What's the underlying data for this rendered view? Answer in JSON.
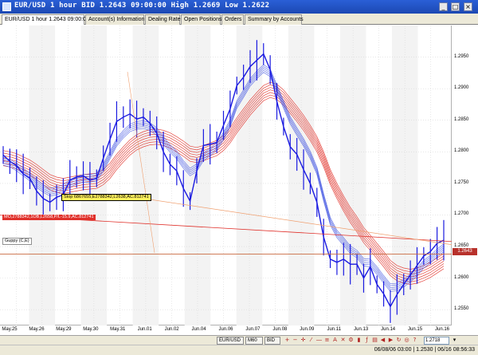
{
  "window": {
    "title": "EUR/USD 1 hour BID 1.2643 09:00:00 High 1.2669 Low 1.2622",
    "minimize": "_",
    "maximize": "□",
    "close": "×"
  },
  "tabs": [
    {
      "label": "EUR/USD 1 hour 1.2643 09:00:00"
    },
    {
      "label": "Account(s) Information"
    },
    {
      "label": "Dealing Rates"
    },
    {
      "label": "Open Positions"
    },
    {
      "label": "Orders"
    },
    {
      "label": "Summary by Accounts"
    }
  ],
  "chart": {
    "annotations": {
      "stop": "Stop 6867655,E2788342,L2638,AC.812741",
      "mo": "MO,2788342,1OB,L2658,P/L-15.9,AC.812741",
      "guppy": "Guppy (C,E)"
    },
    "current_price": "1.2643"
  },
  "chart_data": {
    "type": "line",
    "title": "EUR/USD 1 hour BID",
    "ylim": [
      1.2525,
      1.3
    ],
    "yticks": [
      "1.2950",
      "1.2900",
      "1.2850",
      "1.2800",
      "1.2750",
      "1.2700",
      "1.2650",
      "1.2600",
      "1.2550"
    ],
    "xticks": [
      "May.25",
      "May.26",
      "May.29",
      "May.30",
      "May.31",
      "Jun.01",
      "Jun.02",
      "Jun.04",
      "Jun.06",
      "Jun.07",
      "Jun.08",
      "Jun.09",
      "Jun.11",
      "Jun.13",
      "Jun.14",
      "Jun.15",
      "Jun.16"
    ],
    "price": [
      1.2795,
      1.2785,
      1.2778,
      1.2765,
      1.2758,
      1.2738,
      1.2726,
      1.272,
      1.2728,
      1.2732,
      1.2755,
      1.276,
      1.2762,
      1.2755,
      1.2758,
      1.279,
      1.282,
      1.2848,
      1.2855,
      1.286,
      1.2852,
      1.2855,
      1.2845,
      1.283,
      1.28,
      1.278,
      1.277,
      1.2742,
      1.2722,
      1.277,
      1.281,
      1.2812,
      1.2815,
      1.2842,
      1.2868,
      1.2905,
      1.2918,
      1.2935,
      1.2945,
      1.2955,
      1.293,
      1.288,
      1.284,
      1.2808,
      1.2796,
      1.2772,
      1.275,
      1.272,
      1.2665,
      1.263,
      1.2625,
      1.263,
      1.2622,
      1.2622,
      1.26,
      1.2618,
      1.259,
      1.2575,
      1.2555,
      1.2574,
      1.259,
      1.2605,
      1.262,
      1.2635,
      1.2642,
      1.2655,
      1.266
    ],
    "ma_fast": [
      1.2785,
      1.2782,
      1.2776,
      1.2768,
      1.276,
      1.275,
      1.2742,
      1.2736,
      1.2738,
      1.2742,
      1.275,
      1.2755,
      1.2758,
      1.2758,
      1.276,
      1.2775,
      1.2795,
      1.2815,
      1.2828,
      1.2838,
      1.2842,
      1.2843,
      1.284,
      1.2832,
      1.2818,
      1.2805,
      1.2795,
      1.278,
      1.2768,
      1.2775,
      1.2792,
      1.28,
      1.2808,
      1.2825,
      1.2845,
      1.2875,
      1.2892,
      1.291,
      1.2922,
      1.2932,
      1.2925,
      1.29,
      1.2875,
      1.285,
      1.2832,
      1.2815,
      1.2795,
      1.277,
      1.2728,
      1.269,
      1.267,
      1.2658,
      1.2645,
      1.2638,
      1.2625,
      1.2624,
      1.2612,
      1.2598,
      1.2585,
      1.2586,
      1.2592,
      1.26,
      1.261,
      1.2622,
      1.263,
      1.264,
      1.2648
    ],
    "ma_slow": [
      1.279,
      1.2788,
      1.2785,
      1.278,
      1.2775,
      1.2768,
      1.276,
      1.2752,
      1.2748,
      1.2746,
      1.2748,
      1.275,
      1.2752,
      1.2753,
      1.2754,
      1.276,
      1.277,
      1.2784,
      1.2796,
      1.2807,
      1.2815,
      1.282,
      1.2823,
      1.2824,
      1.2822,
      1.2818,
      1.2812,
      1.2805,
      1.2797,
      1.2795,
      1.2798,
      1.2802,
      1.2806,
      1.2814,
      1.2826,
      1.2842,
      1.2856,
      1.287,
      1.2882,
      1.2893,
      1.2898,
      1.2895,
      1.2886,
      1.2873,
      1.286,
      1.2846,
      1.283,
      1.2812,
      1.2788,
      1.276,
      1.2738,
      1.2718,
      1.27,
      1.2685,
      1.2668,
      1.2656,
      1.2643,
      1.263,
      1.2616,
      1.2608,
      1.2604,
      1.2602,
      1.2604,
      1.2608,
      1.2613,
      1.262,
      1.2627
    ],
    "levels": {
      "mo_entry": 1.2658,
      "stop": 1.2638
    }
  },
  "toolbar": {
    "symbol": "EUR/USD",
    "timeframe": "M60",
    "price_type": "BID",
    "price_input": "1.2718"
  },
  "status": {
    "text": "06/08/06 03:00 | 1.2530 | 06/16 08:56:33"
  },
  "colors": {
    "price": "#1a1ae0",
    "ma_fast": "#3a4de0",
    "ma_slow": "#e02a22",
    "accent": "#b8312b"
  }
}
